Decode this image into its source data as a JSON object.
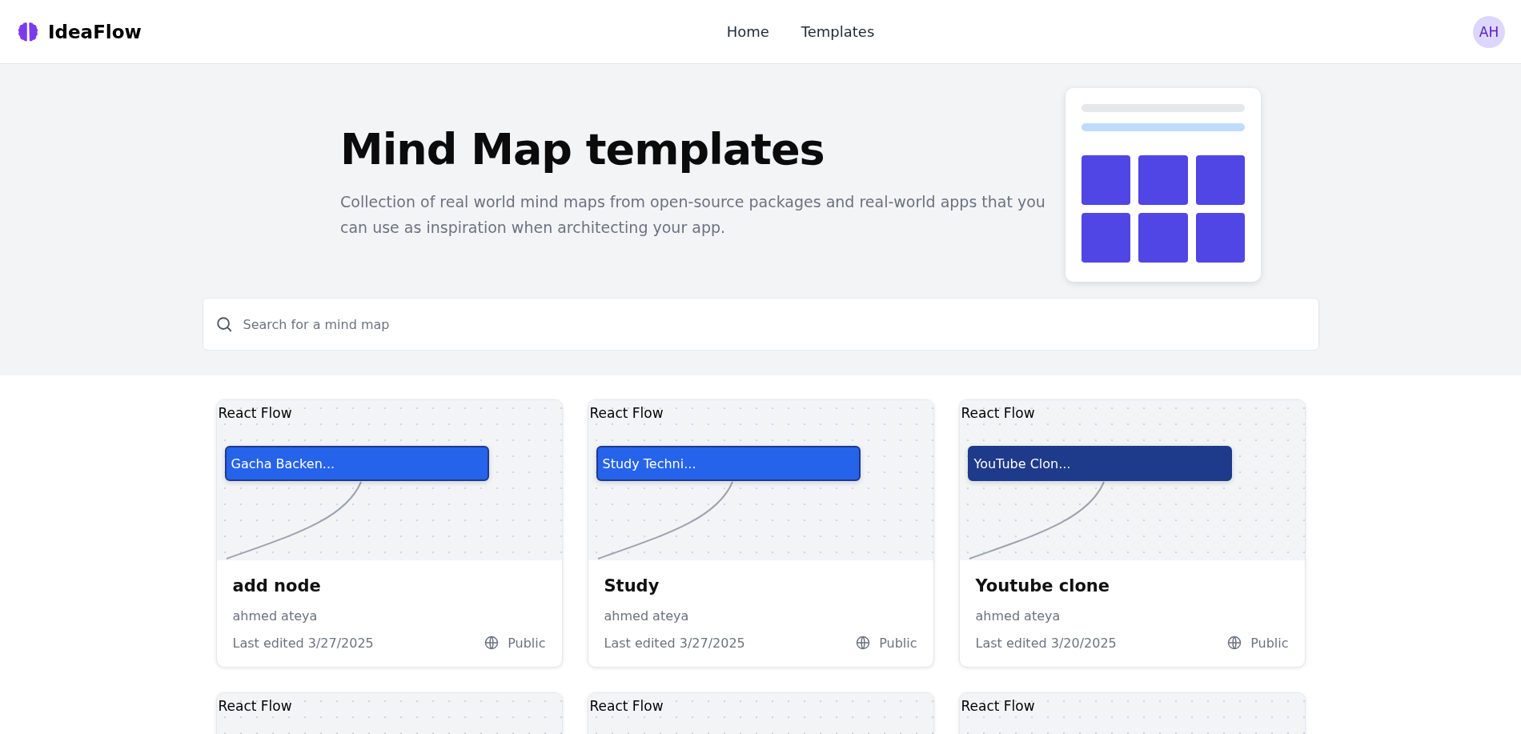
{
  "brand": {
    "name": "IdeaFlow"
  },
  "nav": [
    {
      "label": "Home"
    },
    {
      "label": "Templates"
    }
  ],
  "user": {
    "initials": "AH"
  },
  "hero": {
    "title": "Mind Map templates",
    "subtitle": "Collection of real world mind maps from open-source packages and real-world apps that you can use as inspiration when architecting your app."
  },
  "search": {
    "placeholder": "Search for a mind map"
  },
  "cards": [
    {
      "preview_label": "React Flow",
      "node": {
        "text": "Gacha Backen...",
        "color": "#2563eb"
      },
      "title": "add node",
      "author": "ahmed ateya",
      "edited": "Last edited 3/27/2025",
      "visibility": "Public"
    },
    {
      "preview_label": "React Flow",
      "node": {
        "text": "Study Techni...",
        "color": "#2563eb"
      },
      "title": "Study",
      "author": "ahmed ateya",
      "edited": "Last edited 3/27/2025",
      "visibility": "Public"
    },
    {
      "preview_label": "React Flow",
      "node": {
        "text": "YouTube Clon...",
        "color": "#1e3a8a"
      },
      "title": "Youtube clone",
      "author": "ahmed ateya",
      "edited": "Last edited 3/20/2025",
      "visibility": "Public"
    },
    {
      "preview_label": "React Flow"
    },
    {
      "preview_label": "React Flow"
    },
    {
      "preview_label": "React Flow"
    }
  ]
}
